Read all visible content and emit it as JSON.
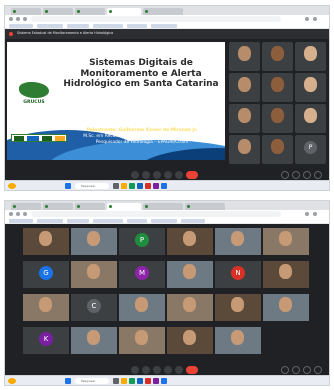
{
  "shot1": {
    "meeting_title": "Sistema Estadual de Monitoramento e Alerta Hidrológico",
    "slide": {
      "title": "Sistemas Digitais de Monitoramento e Alerta Hidrológico em Santa Catarina",
      "logo_text": "GRUCUS",
      "presenter": "Palestrante: Guilherme Xavier de Miranda Jr.",
      "degree": "M.Sc. em Recursos Hídricos e Saneamento Ambiental",
      "role": "Pesquisador de Hidrologia – EPAGRI/Ciram"
    },
    "participants": [
      {
        "name": "",
        "kind": "face"
      },
      {
        "name": "",
        "kind": "face"
      },
      {
        "name": "",
        "kind": "face"
      },
      {
        "name": "",
        "kind": "face"
      },
      {
        "name": "",
        "kind": "face"
      },
      {
        "name": "",
        "kind": "face"
      },
      {
        "name": "",
        "kind": "face"
      },
      {
        "name": "",
        "kind": "face"
      },
      {
        "name": "",
        "kind": "face"
      },
      {
        "name": "",
        "kind": "face"
      },
      {
        "name": "",
        "kind": "face"
      },
      {
        "name": "",
        "kind": "avatar",
        "initial": "P"
      }
    ],
    "meeting_time": "",
    "search_label": "Pesquisar"
  },
  "shot2": {
    "search_label": "Pesquisar",
    "tiles": [
      {
        "kind": "face",
        "name": ""
      },
      {
        "kind": "face",
        "name": ""
      },
      {
        "kind": "avatar",
        "initial": "P",
        "color": "#1e8e3e",
        "name": ""
      },
      {
        "kind": "face",
        "name": ""
      },
      {
        "kind": "face",
        "name": ""
      },
      {
        "kind": "face",
        "name": ""
      },
      {
        "kind": "avatar",
        "initial": "G",
        "color": "#1a73e8",
        "name": ""
      },
      {
        "kind": "face",
        "name": ""
      },
      {
        "kind": "avatar",
        "initial": "M",
        "color": "#8e24aa",
        "name": ""
      },
      {
        "kind": "face",
        "name": ""
      },
      {
        "kind": "avatar",
        "initial": "N",
        "color": "#d93025",
        "name": ""
      },
      {
        "kind": "face",
        "name": ""
      },
      {
        "kind": "face",
        "name": ""
      },
      {
        "kind": "avatar",
        "initial": "C",
        "color": "#5f6368",
        "name": ""
      },
      {
        "kind": "face",
        "name": ""
      },
      {
        "kind": "face",
        "name": ""
      },
      {
        "kind": "face",
        "name": ""
      },
      {
        "kind": "face",
        "name": ""
      },
      {
        "kind": "avatar",
        "initial": "K",
        "color": "#7b1fa2",
        "name": ""
      },
      {
        "kind": "face",
        "name": ""
      },
      {
        "kind": "face",
        "name": ""
      },
      {
        "kind": "face",
        "name": ""
      },
      {
        "kind": "face",
        "name": ""
      }
    ]
  }
}
